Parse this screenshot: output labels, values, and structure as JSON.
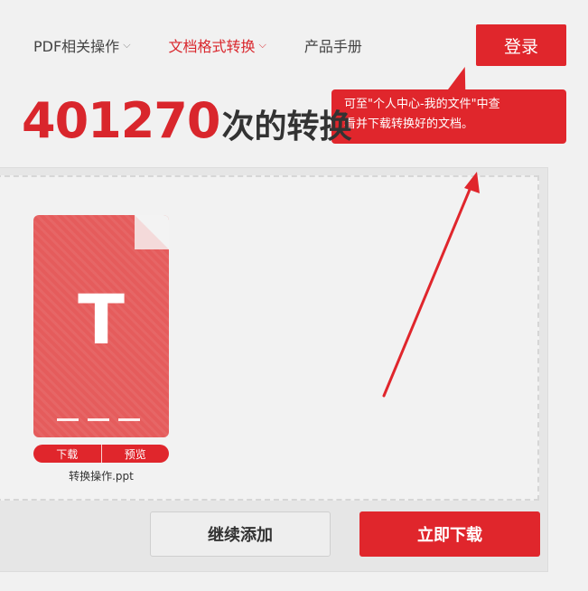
{
  "nav": {
    "items": [
      {
        "label": "PDF相关操作",
        "has_dropdown": true,
        "active": false
      },
      {
        "label": "文档格式转换",
        "has_dropdown": true,
        "active": true
      },
      {
        "label": "产品手册",
        "has_dropdown": false,
        "active": false
      }
    ],
    "chevron": "⌵"
  },
  "login": {
    "label": "登录"
  },
  "tooltip": {
    "line1": "可至\"个人中心-我的文件\"中查",
    "line2": "看并下载转换好的文档。"
  },
  "headline": {
    "prefix": "：",
    "count": "401270",
    "suffix": "次的转换"
  },
  "file": {
    "icon_letter": "T",
    "download_label": "下载",
    "preview_label": "预览",
    "name": "转换操作.ppt"
  },
  "actions": {
    "continue_label": "继续添加",
    "download_now_label": "立即下载"
  },
  "colors": {
    "accent": "#e0262c",
    "file_card": "#e55c5c"
  }
}
